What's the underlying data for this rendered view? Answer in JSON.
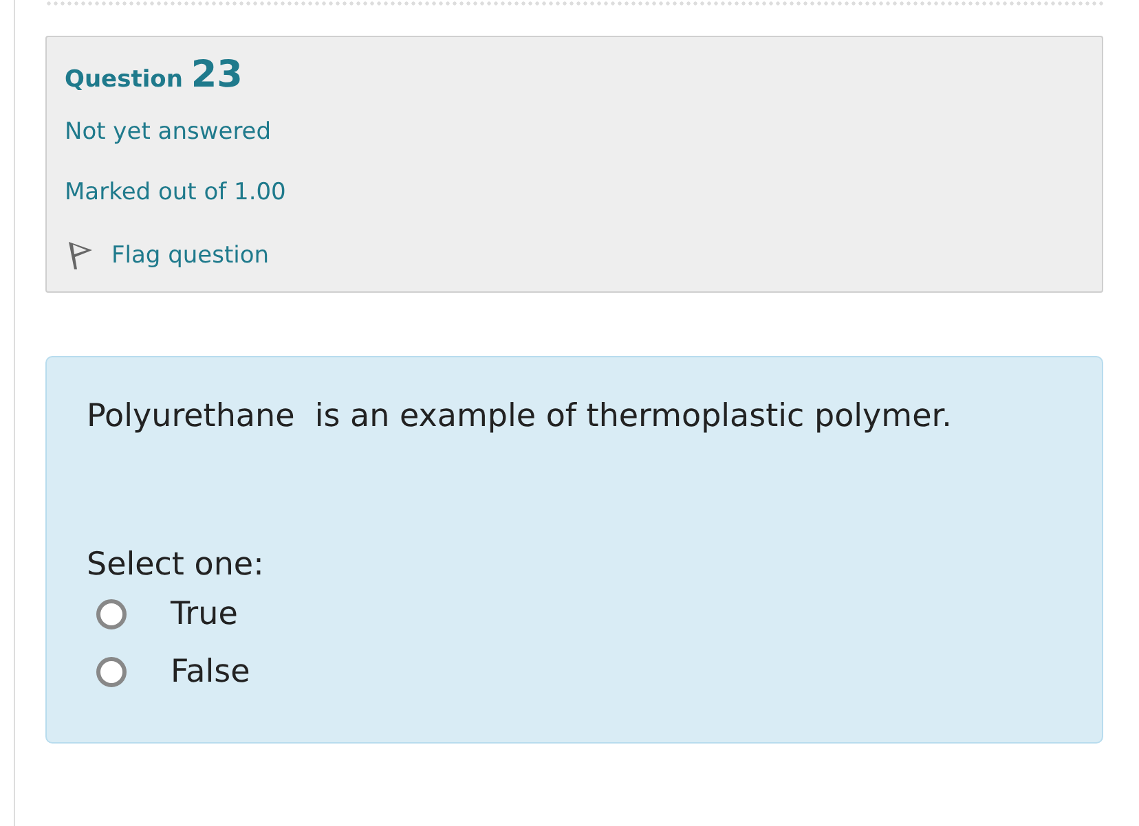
{
  "question": {
    "label": "Question",
    "number": "23",
    "status": "Not yet answered",
    "marks": "Marked out of 1.00",
    "flag": {
      "label": "Flag question",
      "flagged": false
    }
  },
  "content": {
    "text": "Polyurethane  is an example of thermoplastic polymer.",
    "prompt": "Select one:",
    "options": [
      {
        "label": "True",
        "selected": false
      },
      {
        "label": "False",
        "selected": false
      }
    ]
  }
}
